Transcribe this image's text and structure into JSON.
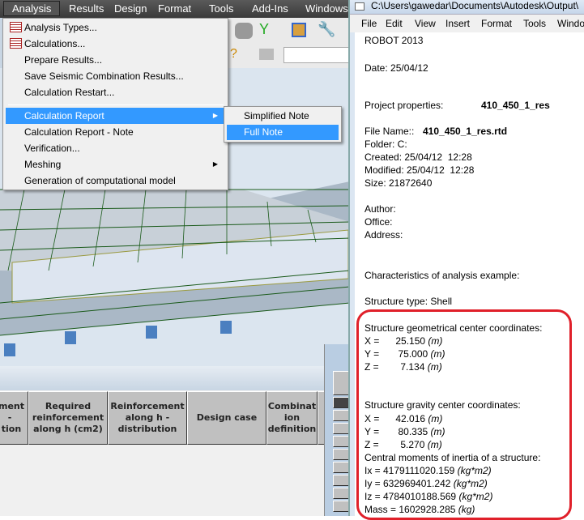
{
  "app": {
    "menubar": [
      "Analysis",
      "Results",
      "Design",
      "Format",
      "Tools",
      "Add-Ins",
      "Windows"
    ],
    "analysis_menu": [
      {
        "label": "Analysis Types...",
        "icon": "analysis-types-icon"
      },
      {
        "label": "Calculations...",
        "icon": "calculations-icon"
      },
      {
        "label": "Prepare Results..."
      },
      {
        "label": "Save Seismic Combination Results..."
      },
      {
        "label": "Calculation Restart..."
      },
      {
        "label": "Calculation Report",
        "submenu": true,
        "highlighted": true
      },
      {
        "label": "Calculation Report - Note"
      },
      {
        "label": "Verification..."
      },
      {
        "label": "Meshing",
        "submenu": true
      },
      {
        "label": "Generation of computational model"
      }
    ],
    "report_submenu": [
      {
        "label": "Simplified Note"
      },
      {
        "label": "Full Note",
        "highlighted": true
      }
    ],
    "table_headers": [
      "ment\n- \ntion",
      "Required reinforcement along h (cm2)",
      "Reinforcement along h - distribution",
      "Design case",
      "Combinat ion definition"
    ]
  },
  "note": {
    "title": "C:\\Users\\gawedar\\Documents\\Autodesk\\Output\\",
    "menu": [
      "File",
      "Edit",
      "View",
      "Insert",
      "Format",
      "Tools",
      "Windo"
    ],
    "lines": {
      "product": "ROBOT 2013",
      "date": "Date: 25/04/12",
      "project_label": "Project properties:",
      "project_value": "410_450_1_res",
      "file_label": "File Name::",
      "file_value": "410_450_1_res.rtd",
      "folder": "Folder: C:",
      "created": "Created: 25/04/12  12:28",
      "modified": "Modified: 25/04/12  12:28",
      "size": "Size: 21872640",
      "author": "Author:",
      "office": "Office:",
      "address": "Address:",
      "characteristics": "Characteristics of analysis example:",
      "structure_type": "Structure type: Shell",
      "geo_heading": "Structure geometrical center coordinates:",
      "geo_x": "X =      25.150",
      "geo_y": "Y =       75.000",
      "geo_z": "Z =        7.134",
      "grav_heading": "Structure gravity center coordinates:",
      "grav_x": "X =      42.016",
      "grav_y": "Y =       80.335",
      "grav_z": "Z =        5.270",
      "unit_m": "(m)",
      "inertia_heading": "Central moments of inertia of a structure:",
      "ix": "Ix = 4179111020.159",
      "iy": "Iy = 632969401.242",
      "iz": "Iz = 4784010188.569",
      "unit_kgm2": "(kg*m2)",
      "mass": "Mass = 1602928.285",
      "unit_kg": "(kg)"
    }
  },
  "colors": {
    "highlight": "#3399ff",
    "annotation": "#e0202a"
  }
}
